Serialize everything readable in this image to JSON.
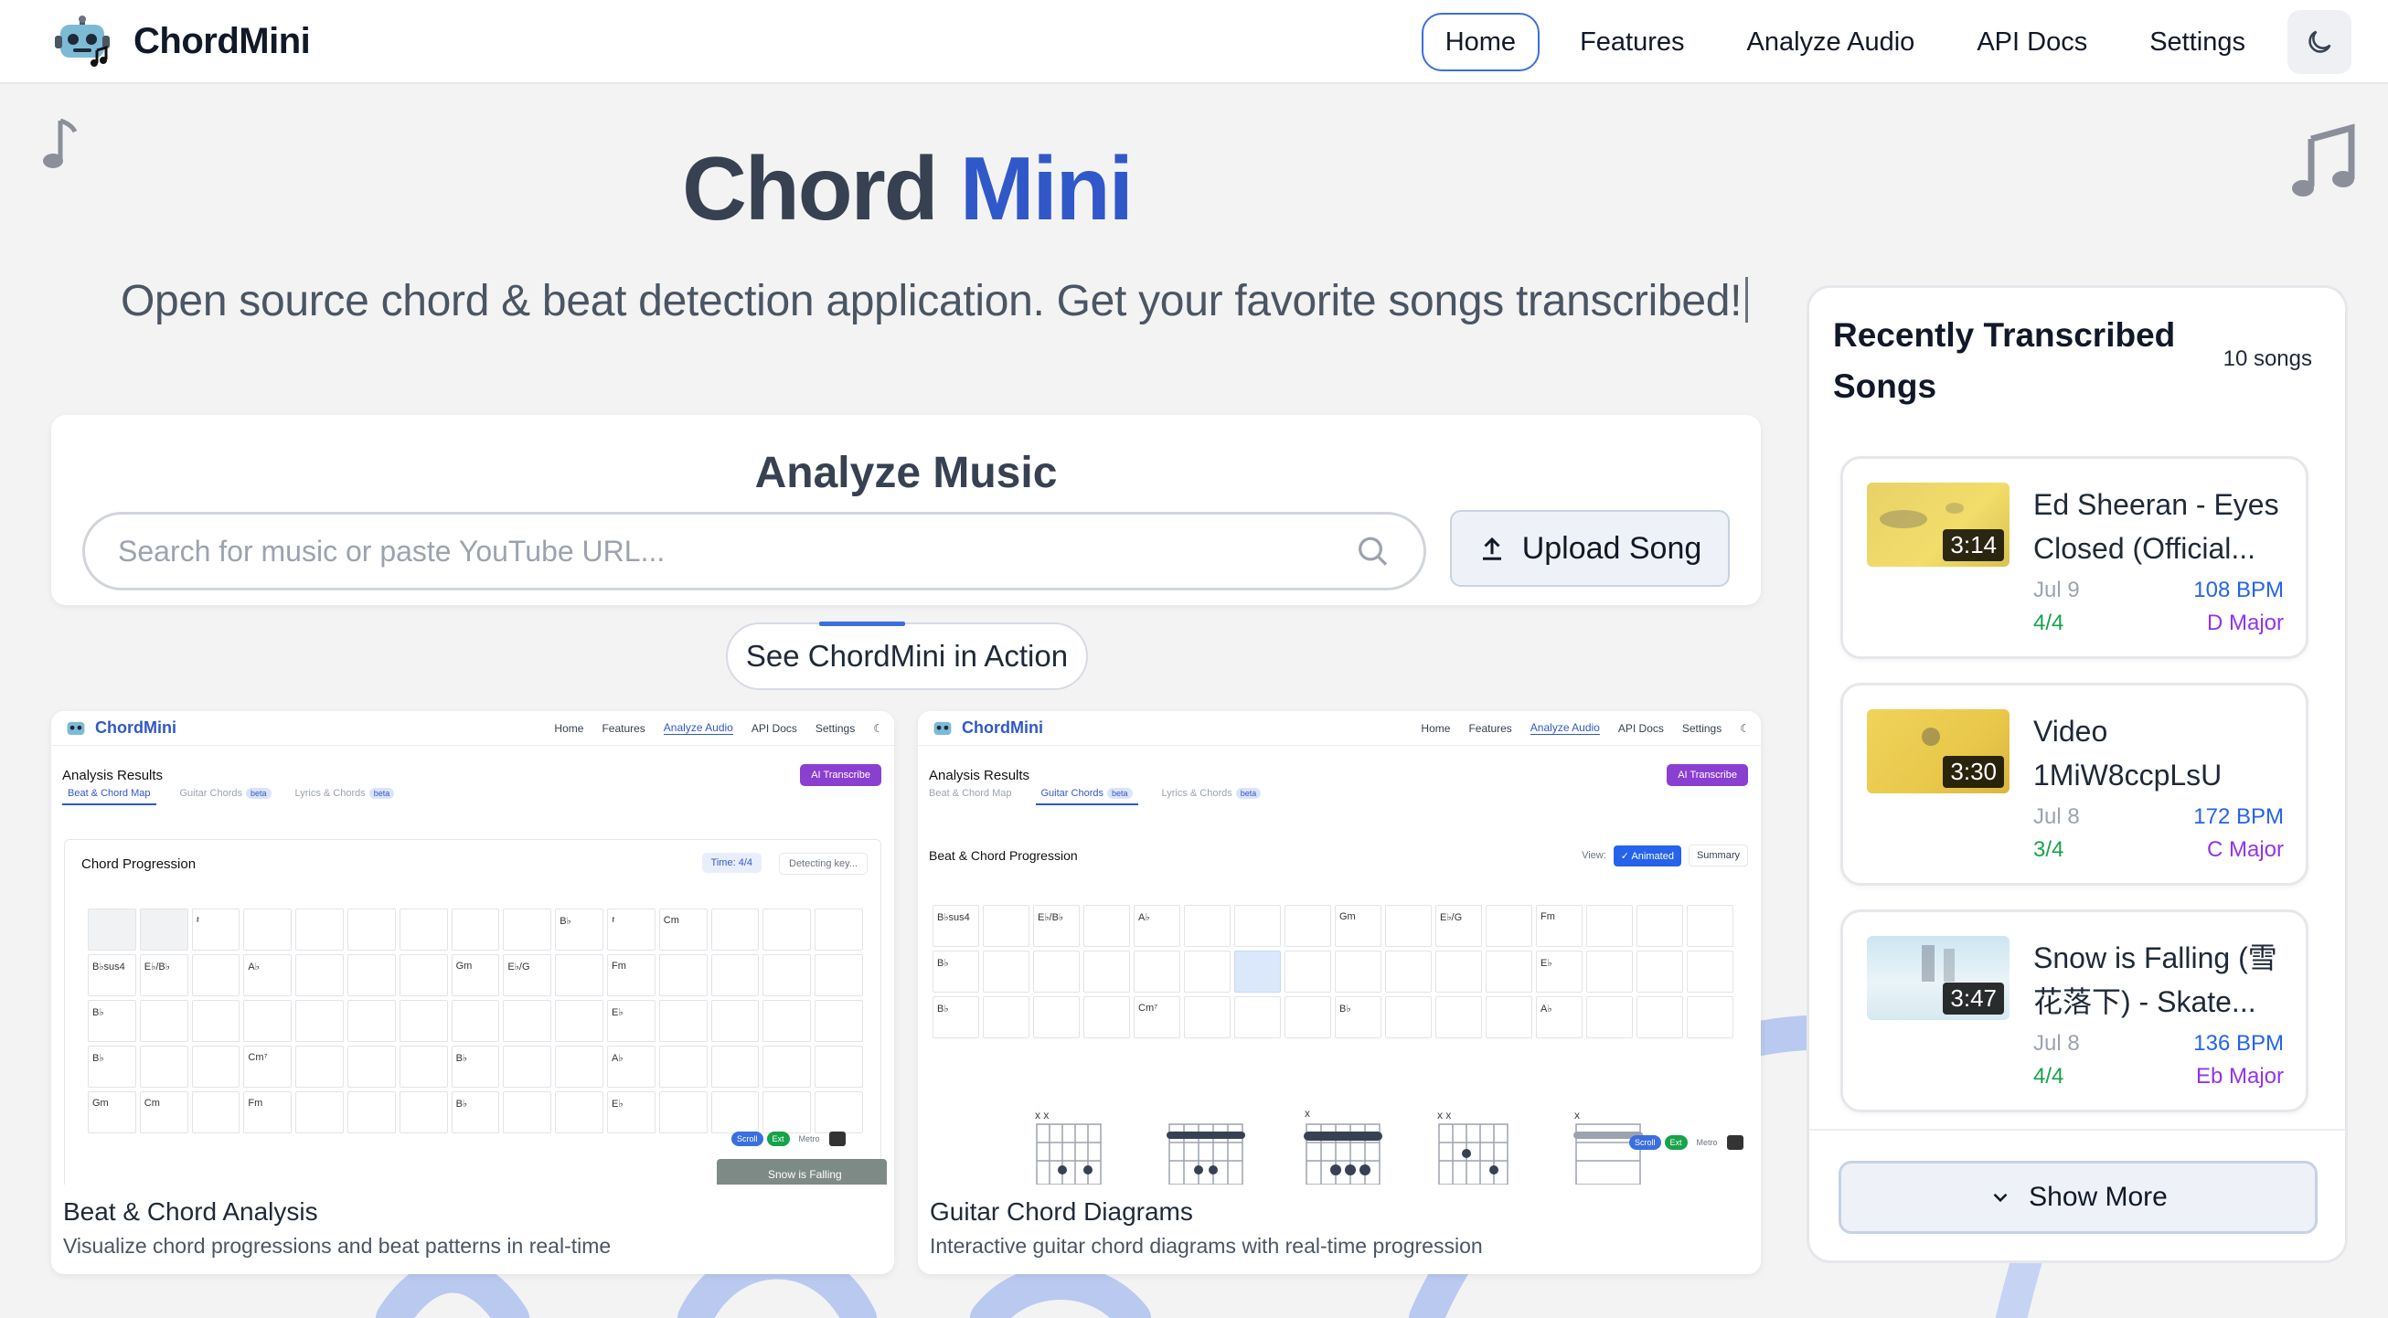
{
  "nav": {
    "brand": "ChordMini",
    "links": [
      "Home",
      "Features",
      "Analyze Audio",
      "API Docs",
      "Settings"
    ],
    "active": "Home"
  },
  "hero": {
    "title_part1": "Chord",
    "title_part2": "Mini",
    "subtitle": "Open source chord & beat detection application. Get your favorite songs transcribed!"
  },
  "analyze": {
    "title": "Analyze Music",
    "search_placeholder": "Search for music or paste YouTube URL...",
    "upload_label": "Upload Song"
  },
  "demo_button": "See ChordMini in Action",
  "demos": [
    {
      "title": "Beat & Chord Analysis",
      "description": "Visualize chord progressions and beat patterns in real-time",
      "shot": {
        "brand": "ChordMini",
        "links": [
          "Home",
          "Features",
          "Analyze Audio",
          "API Docs",
          "Settings"
        ],
        "heading": "Analysis Results",
        "ai_button": "AI Transcribe",
        "tabs": [
          "Beat & Chord Map",
          "Guitar Chords",
          "Lyrics & Chords"
        ],
        "beta": "beta",
        "section": "Chord Progression",
        "time_badge": "Time: 4/4",
        "key_badge": "Detecting key...",
        "rows": [
          [
            "",
            "",
            "𝄽",
            "",
            "",
            "",
            "",
            "",
            "",
            "B♭",
            "𝄽",
            "Cm",
            "",
            "",
            ""
          ],
          [
            "B♭sus4",
            "E♭/B♭",
            "",
            "A♭",
            "",
            "",
            "",
            "Gm",
            "E♭/G",
            "",
            "Fm",
            "",
            "",
            "",
            ""
          ],
          [
            "B♭",
            "",
            "",
            "",
            "",
            "",
            "",
            "",
            "",
            "",
            "E♭",
            "",
            "",
            "",
            ""
          ],
          [
            "B♭",
            "",
            "",
            "Cm⁷",
            "",
            "",
            "",
            "B♭",
            "",
            "",
            "A♭",
            "",
            "",
            "",
            ""
          ],
          [
            "Gm",
            "Cm",
            "",
            "Fm",
            "",
            "",
            "",
            "B♭",
            "",
            "",
            "E♭",
            "",
            "",
            "",
            ""
          ]
        ],
        "toggles": [
          "Scroll",
          "Ext",
          "Metro"
        ],
        "video_overlay": "Snow is Falling"
      }
    },
    {
      "title": "Guitar Chord Diagrams",
      "description": "Interactive guitar chord diagrams with real-time progression",
      "shot": {
        "brand": "ChordMini",
        "links": [
          "Home",
          "Features",
          "Analyze Audio",
          "API Docs",
          "Settings"
        ],
        "heading": "Analysis Results",
        "ai_button": "AI Transcribe",
        "tabs": [
          "Beat & Chord Map",
          "Guitar Chords",
          "Lyrics & Chords"
        ],
        "beta": "beta",
        "section": "Beat & Chord Progression",
        "view_label": "View:",
        "view_options": [
          "✓ Animated",
          "Summary"
        ],
        "rows": [
          [
            "B♭sus4",
            "",
            "E♭/B♭",
            "",
            "A♭",
            "",
            "",
            "",
            "Gm",
            "",
            "E♭/G",
            "",
            "Fm",
            "",
            "",
            ""
          ],
          [
            "B♭",
            "",
            "",
            "",
            "",
            "",
            "",
            "",
            "",
            "",
            "",
            "",
            "E♭",
            "",
            "",
            ""
          ],
          [
            "B♭",
            "",
            "",
            "",
            "Cm⁷",
            "",
            "",
            "",
            "B♭",
            "",
            "",
            "",
            "A♭",
            "",
            "",
            ""
          ]
        ],
        "toggles": [
          "Scroll",
          "Ext",
          "Metro"
        ]
      }
    }
  ],
  "recent": {
    "title": "Recently Transcribed Songs",
    "count": "10 songs",
    "songs": [
      {
        "title": "Ed Sheeran - Eyes Closed (Official...",
        "duration": "3:14",
        "date": "Jul 9",
        "bpm": "108 BPM",
        "time_sig": "4/4",
        "key": "D Major"
      },
      {
        "title": "Video 1MiW8ccpLsU",
        "duration": "3:30",
        "date": "Jul 8",
        "bpm": "172 BPM",
        "time_sig": "3/4",
        "key": "C Major"
      },
      {
        "title": "Snow is Falling (雪花落下) - Skate...",
        "duration": "3:47",
        "date": "Jul 8",
        "bpm": "136 BPM",
        "time_sig": "4/4",
        "key": "Eb Major"
      }
    ],
    "show_more": "Show More"
  },
  "colors": {
    "accent": "#3158c9",
    "bpm": "#2563eb",
    "time_sig": "#16a34a",
    "key": "#9333ea",
    "ai_button": "#8b3fd1"
  }
}
